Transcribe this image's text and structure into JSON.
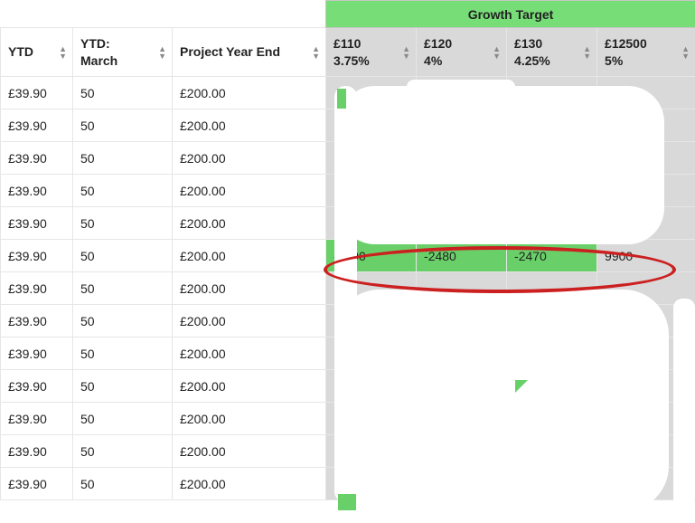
{
  "header": {
    "group_title": "Growth Target",
    "columns": [
      {
        "label": "YTD"
      },
      {
        "label": "YTD:\nMarch"
      },
      {
        "label": "Project Year End"
      },
      {
        "line1": "£110",
        "line2": "3.75%"
      },
      {
        "line1": "£120",
        "line2": "4%"
      },
      {
        "line1": "£130",
        "line2": "4.25%"
      },
      {
        "line1": "£12500",
        "line2": "5%"
      }
    ]
  },
  "rows": [
    {
      "ytd": "£39.90",
      "ytd_march": "50",
      "pye": "£200.00",
      "c1": "",
      "c2": "",
      "c3": "",
      "c4": ""
    },
    {
      "ytd": "£39.90",
      "ytd_march": "50",
      "pye": "£200.00",
      "c1": "",
      "c2": "",
      "c3": "",
      "c4": ""
    },
    {
      "ytd": "£39.90",
      "ytd_march": "50",
      "pye": "£200.00",
      "c1": "",
      "c2": "",
      "c3": "",
      "c4": ""
    },
    {
      "ytd": "£39.90",
      "ytd_march": "50",
      "pye": "£200.00",
      "c1": "",
      "c2": "",
      "c3": "",
      "c4": ""
    },
    {
      "ytd": "£39.90",
      "ytd_march": "50",
      "pye": "£200.00",
      "c1": "",
      "c2": "",
      "c3": "",
      "c4": ""
    },
    {
      "ytd": "£39.90",
      "ytd_march": "50",
      "pye": "£200.00",
      "c1": "-2490",
      "c2": "-2480",
      "c3": "-2470",
      "c4": "9900",
      "highlight": true
    },
    {
      "ytd": "£39.90",
      "ytd_march": "50",
      "pye": "£200.00",
      "c1": "",
      "c2": "",
      "c3": "",
      "c4": ""
    },
    {
      "ytd": "£39.90",
      "ytd_march": "50",
      "pye": "£200.00",
      "c1": "",
      "c2": "",
      "c3": "",
      "c4": ""
    },
    {
      "ytd": "£39.90",
      "ytd_march": "50",
      "pye": "£200.00",
      "c1": "",
      "c2": "",
      "c3": "",
      "c4": ""
    },
    {
      "ytd": "£39.90",
      "ytd_march": "50",
      "pye": "£200.00",
      "c1": "",
      "c2": "",
      "c3": "",
      "c4": ""
    },
    {
      "ytd": "£39.90",
      "ytd_march": "50",
      "pye": "£200.00",
      "c1": "",
      "c2": "",
      "c3": "",
      "c4": ""
    },
    {
      "ytd": "£39.90",
      "ytd_march": "50",
      "pye": "£200.00",
      "c1": "",
      "c2": "",
      "c3": "",
      "c4": ""
    },
    {
      "ytd": "£39.90",
      "ytd_march": "50",
      "pye": "£200.00",
      "c1": "",
      "c2": "",
      "c3": "",
      "c4": ""
    }
  ],
  "annotation": {
    "circle_row_index": 5
  }
}
